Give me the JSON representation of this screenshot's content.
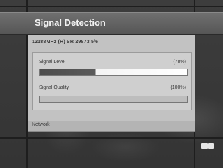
{
  "title": "Signal Detection",
  "transponder": "12188MHz (H)  SR 29873  5/6",
  "signal_level": {
    "label": "Signal Level",
    "value_text": "(78%)",
    "percent": 78
  },
  "signal_quality": {
    "label": "Signal Quality",
    "value_text": "(100%)",
    "percent": 100
  },
  "network": {
    "label": "Network"
  },
  "icons": {
    "bottom_right": "remote-key-icon"
  }
}
